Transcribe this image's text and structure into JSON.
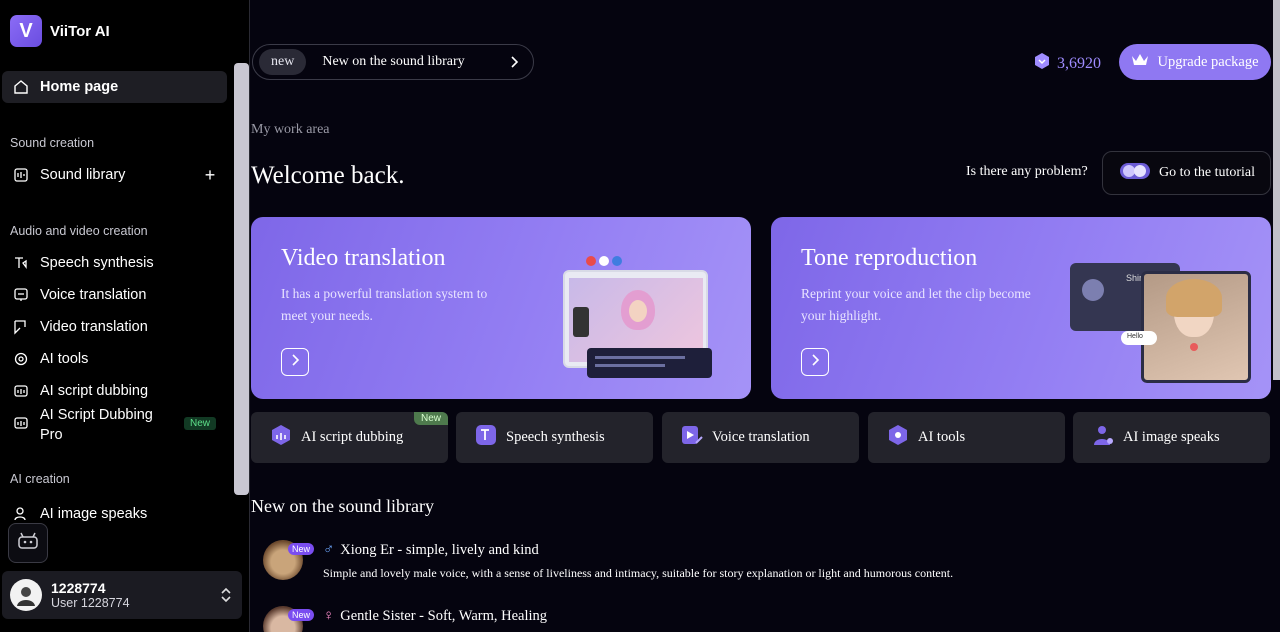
{
  "brand": {
    "logo_letter": "V",
    "name": "ViiTor AI"
  },
  "sidebar": {
    "home": "Home page",
    "sections": [
      {
        "title": "Sound creation"
      },
      {
        "title": "Audio and video creation"
      },
      {
        "title": "AI creation"
      }
    ],
    "sound_library": "Sound library",
    "items": [
      {
        "label": "Speech synthesis",
        "icon": "speech-synthesis-icon"
      },
      {
        "label": "Voice translation",
        "icon": "voice-translation-icon"
      },
      {
        "label": "Video translation",
        "icon": "video-translation-icon"
      },
      {
        "label": "AI tools",
        "icon": "ai-tools-icon"
      },
      {
        "label": "AI script dubbing",
        "icon": "ai-script-dubbing-icon"
      },
      {
        "label": "AI Script Dubbing Pro",
        "icon": "ai-script-dubbing-pro-icon",
        "badge": "New"
      }
    ],
    "ai_image_speaks": "AI image speaks",
    "user": {
      "name": "1228774",
      "subtitle": "User 1228774"
    }
  },
  "header": {
    "pill_tag": "new",
    "pill_text": "New on the sound library",
    "credits": "3,6920",
    "upgrade": "Upgrade package"
  },
  "main": {
    "work_area": "My work area",
    "welcome": "Welcome back.",
    "problem": "Is there any problem?",
    "tutorial": "Go to the tutorial",
    "cards": [
      {
        "title": "Video translation",
        "desc": "It has a powerful translation system to meet your needs."
      },
      {
        "title": "Tone reproduction",
        "desc": "Reprint your voice and let the clip become your highlight."
      }
    ],
    "card_overlay": {
      "shirt": "Shirt",
      "hello": "Hello"
    },
    "tools": [
      {
        "label": "AI script dubbing",
        "badge": "New"
      },
      {
        "label": "Speech synthesis"
      },
      {
        "label": "Voice translation"
      },
      {
        "label": "AI tools"
      },
      {
        "label": "AI image speaks"
      }
    ],
    "library_title": "New on the sound library",
    "voices": [
      {
        "name": "Xiong Er - simple, lively and kind",
        "gender": "♂",
        "badge": "New",
        "desc": "Simple and lovely male voice, with a sense of liveliness and intimacy, suitable for story explanation or light and humorous content."
      },
      {
        "name": "Gentle Sister - Soft, Warm, Healing",
        "gender": "♀",
        "badge": "New",
        "desc": ""
      }
    ]
  },
  "colors": {
    "accent": "#8f78f2",
    "card_gradient_start": "#7e67e8",
    "credits": "#9f8cff",
    "new_badge": "#5ee08a"
  }
}
